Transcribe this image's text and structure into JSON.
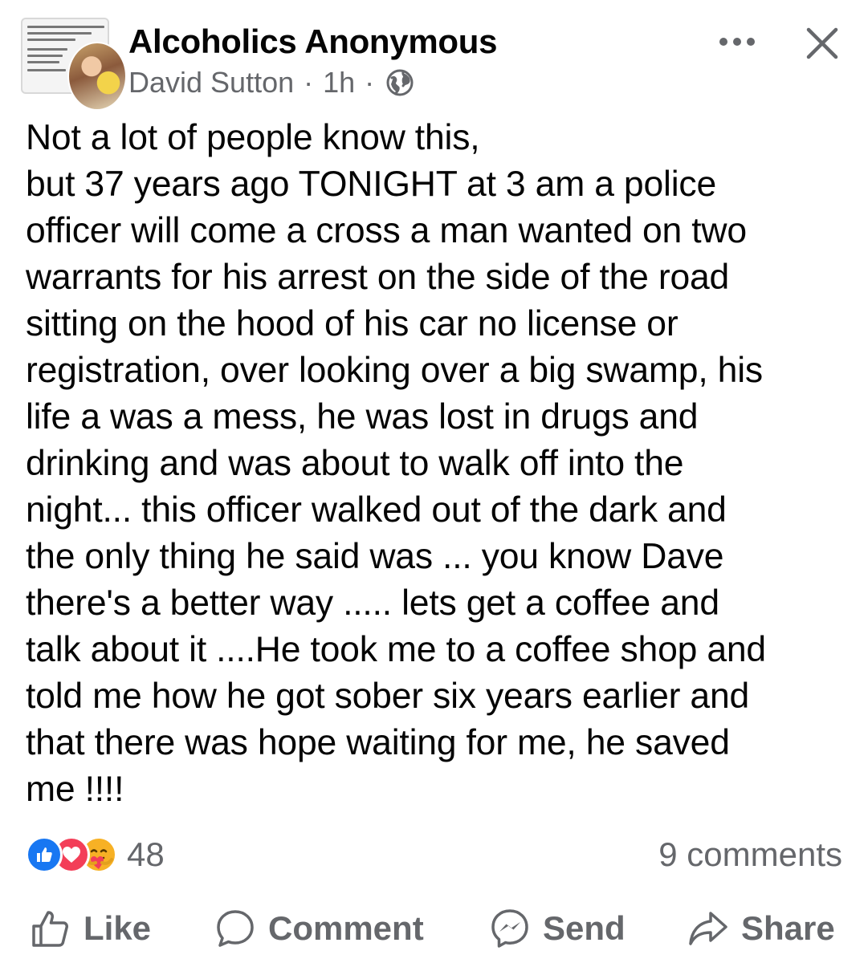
{
  "header": {
    "group_name": "Alcoholics Anonymous",
    "author": "David Sutton",
    "separator": "·",
    "time": "1h",
    "privacy_icon": "globe-icon",
    "more_icon": "more-horizontal-icon",
    "close_icon": "close-icon",
    "avatar_doc_lines": [
      "official AA Group and is not affiliated with",
      "This is only a Facebook",
      "for those interested",
      "Membership is",
      "they are a",
      "may be viewed",
      "anonymity is each"
    ]
  },
  "post": {
    "lines": [
      "Not a lot of people know this,",
      "but 37 years ago TONIGHT at 3 am a police",
      "officer will come a cross a man wanted on two",
      "warrants for his arrest on the side of the road",
      "sitting on the hood of his car no license or",
      "registration, over looking over a big swamp, his",
      "life a was a mess, he was lost in drugs and",
      "drinking and was about to walk off into the",
      "night... this officer walked out of the dark and",
      "the only thing he said was ... you know Dave",
      "there's a better way ..... lets get a coffee and",
      "talk about it ....He took me to a coffee shop and",
      "told me how he got sober six years earlier and",
      "that there was hope waiting for me, he saved",
      "me !!!!"
    ]
  },
  "engagement": {
    "reaction_icons": [
      "like-reaction-icon",
      "love-reaction-icon",
      "care-reaction-icon"
    ],
    "reaction_count": "48",
    "comments": "9 comments"
  },
  "actions": {
    "like": "Like",
    "comment": "Comment",
    "send": "Send",
    "share": "Share"
  },
  "colors": {
    "text": "#050505",
    "secondary": "#65676b",
    "like_blue": "#1877f2",
    "love_red": "#f33e58",
    "care_yellow": "#f7b125"
  }
}
